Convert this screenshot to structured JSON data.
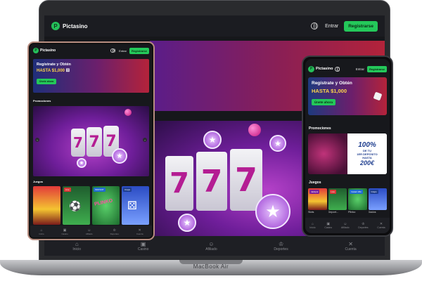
{
  "brand": {
    "name": "Pictasino",
    "logo_letter": "P",
    "accent": "#24c85a"
  },
  "nav": {
    "login_label": "Entrar",
    "register_label": "Registrarse"
  },
  "hero": {
    "line1": "Regístrate y Obtén",
    "line2": "HASTA $1,000",
    "cta": "Únete ahora"
  },
  "sections": {
    "promos": "Promociones",
    "games": "Juegos"
  },
  "promo_banner": {
    "percent": "100%",
    "line1": "DE TU",
    "line2": "1ER DEPÓSITO",
    "line3": "HASTA",
    "amount": "200€"
  },
  "games": [
    {
      "name": "Slots",
      "tag": "Jackpot"
    },
    {
      "name": "Deport...",
      "tag": "Live"
    },
    {
      "name": "Plinko",
      "tag": "Instant Win"
    },
    {
      "name": "Dados",
      "tag": "Craps"
    }
  ],
  "game_tags_tablet": {
    "live": "Live",
    "instant": "INSTANT",
    "craps": "Craps"
  },
  "plinko_art_text": "PLINKO",
  "slot_symbol": "7",
  "bottom_nav": [
    {
      "label": "Inicio",
      "icon": "home-icon"
    },
    {
      "label": "Casino",
      "icon": "slot-machine-icon"
    },
    {
      "label": "Afiliado",
      "icon": "users-icon"
    },
    {
      "label": "Deportes",
      "icon": "trophy-icon"
    },
    {
      "label": "Cuenta",
      "icon": "account-icon"
    }
  ],
  "device_label": "MacBook Air"
}
